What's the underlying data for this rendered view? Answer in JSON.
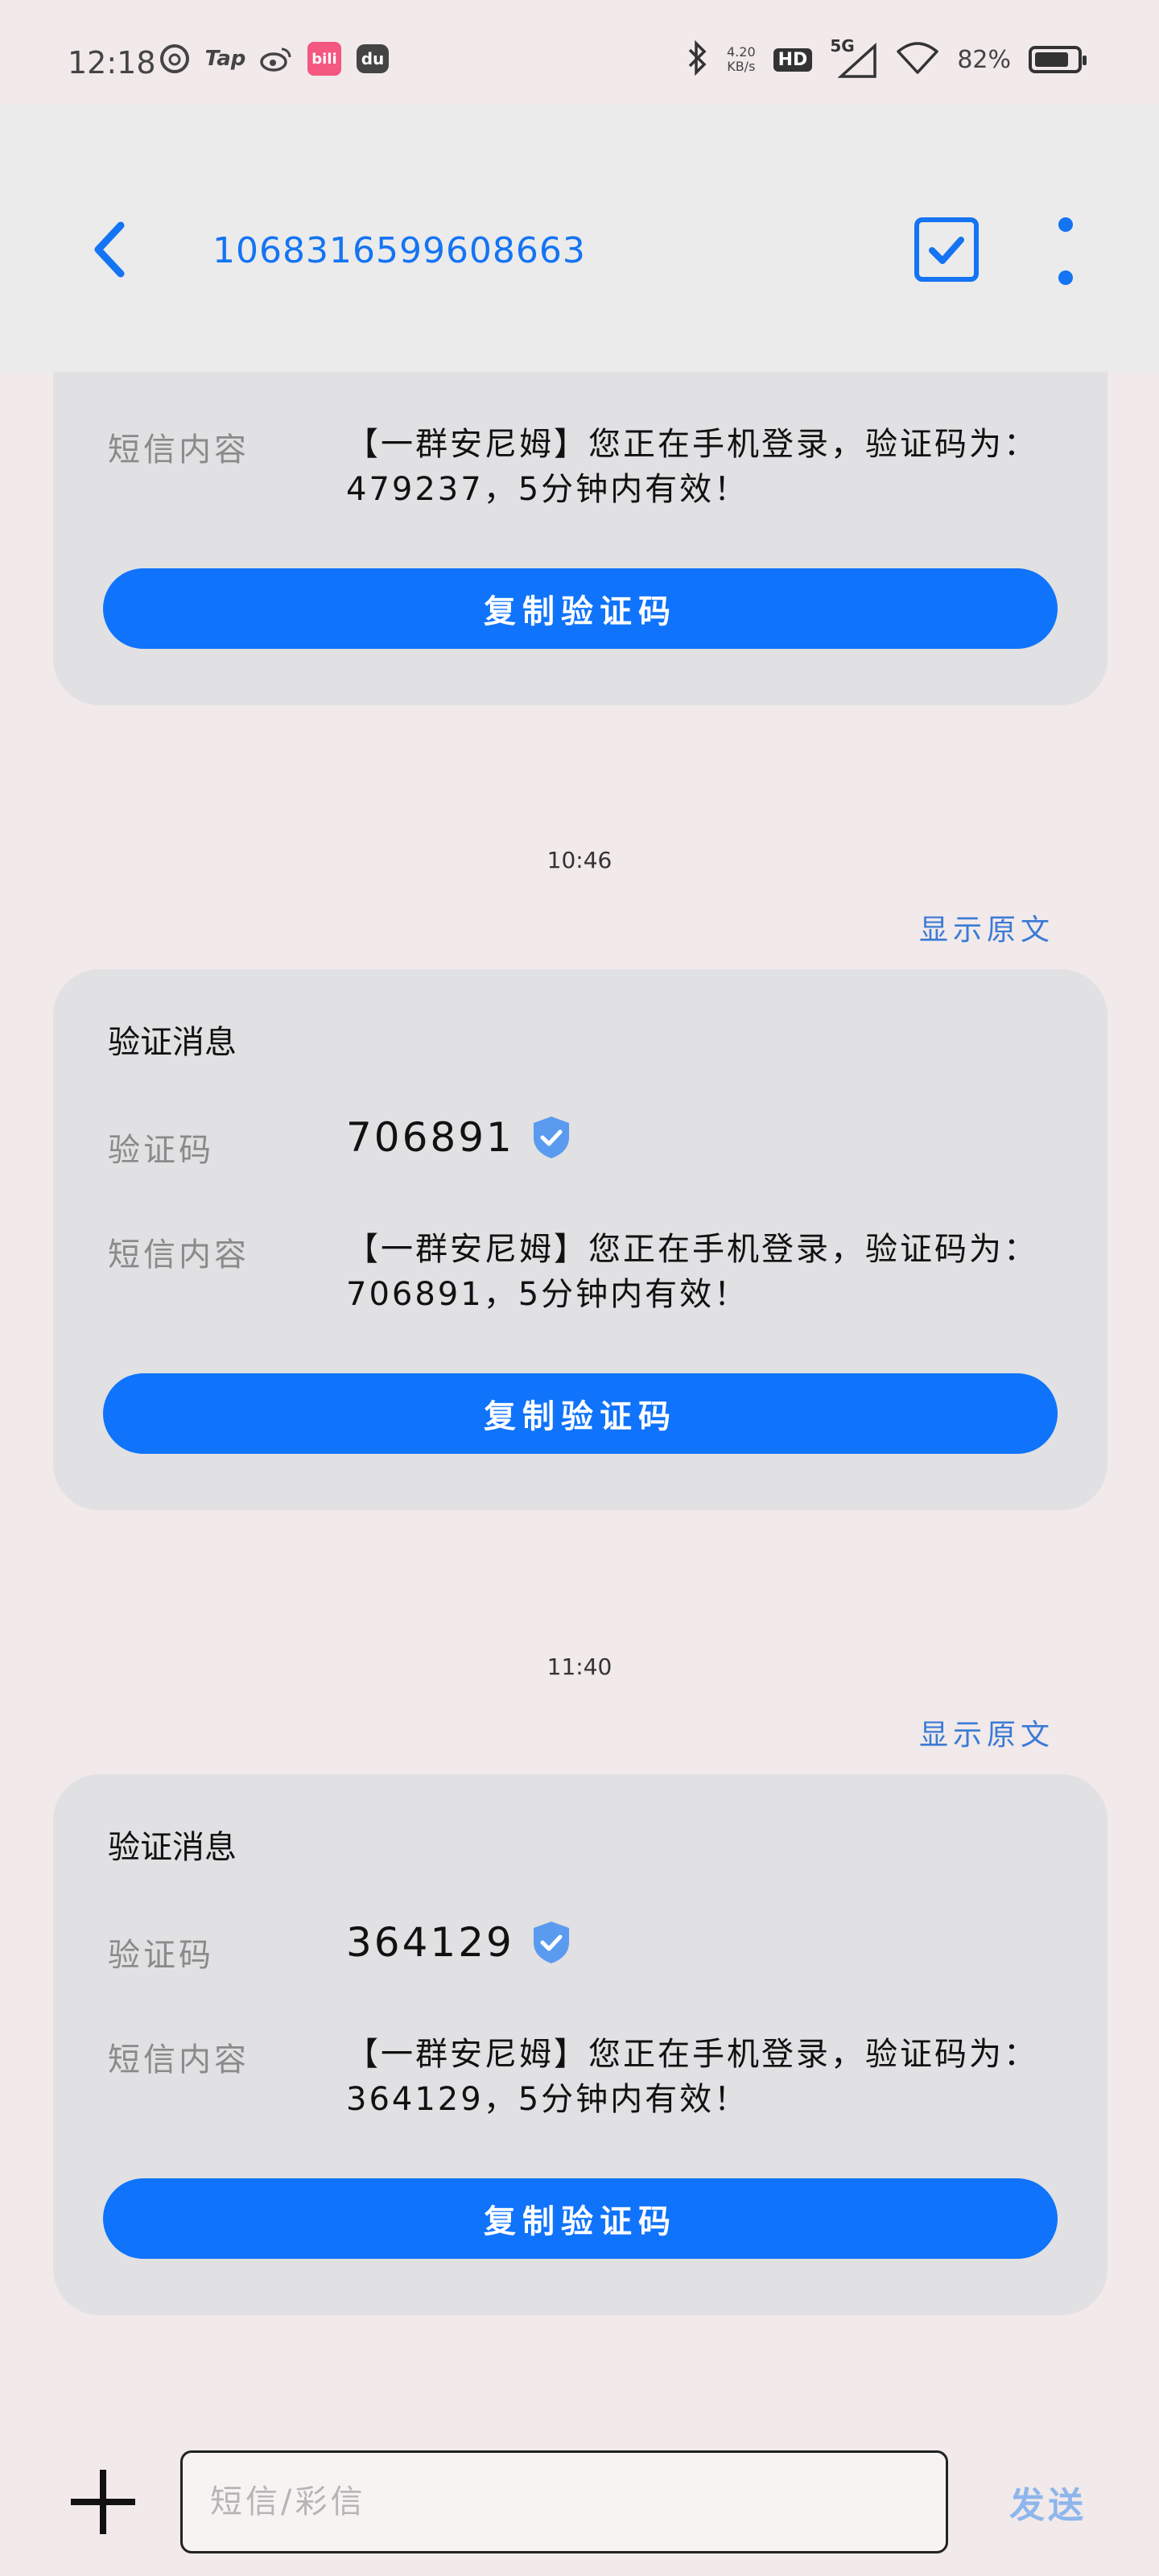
{
  "status_bar": {
    "time": "12:18",
    "app_icons": [
      "netease-music-icon",
      "taptap-icon",
      "weibo-icon",
      "bilibili-icon",
      "dewu-icon"
    ],
    "tap_label": "Tap",
    "bili_label": "bili",
    "du_label": "du",
    "net_speed_value": "4.20",
    "net_speed_unit": "KB/s",
    "hd_label": "HD",
    "network_label": "5G",
    "battery": "82%"
  },
  "header": {
    "contact": "1068316599608663"
  },
  "messages": [
    {
      "title": "",
      "code_label": "",
      "code": "",
      "content_label": "短信内容",
      "content": "【一群安尼姆】您正在手机登录，验证码为：479237，5分钟内有效！",
      "copy_label": "复制验证码"
    },
    {
      "timestamp": "10:46",
      "show_original": "显示原文",
      "title": "验证消息",
      "code_label": "验证码",
      "code": "706891",
      "content_label": "短信内容",
      "content": "【一群安尼姆】您正在手机登录，验证码为：706891，5分钟内有效！",
      "copy_label": "复制验证码"
    },
    {
      "timestamp": "11:40",
      "show_original": "显示原文",
      "title": "验证消息",
      "code_label": "验证码",
      "code": "364129",
      "content_label": "短信内容",
      "content": "【一群安尼姆】您正在手机登录，验证码为：364129，5分钟内有效！",
      "copy_label": "复制验证码"
    }
  ],
  "composer": {
    "placeholder": "短信/彩信",
    "send_label": "发送"
  },
  "colors": {
    "accent": "#0f73fb",
    "background": "#f1e9ea",
    "card": "#e1e0e2",
    "link": "#3a7ad6"
  }
}
